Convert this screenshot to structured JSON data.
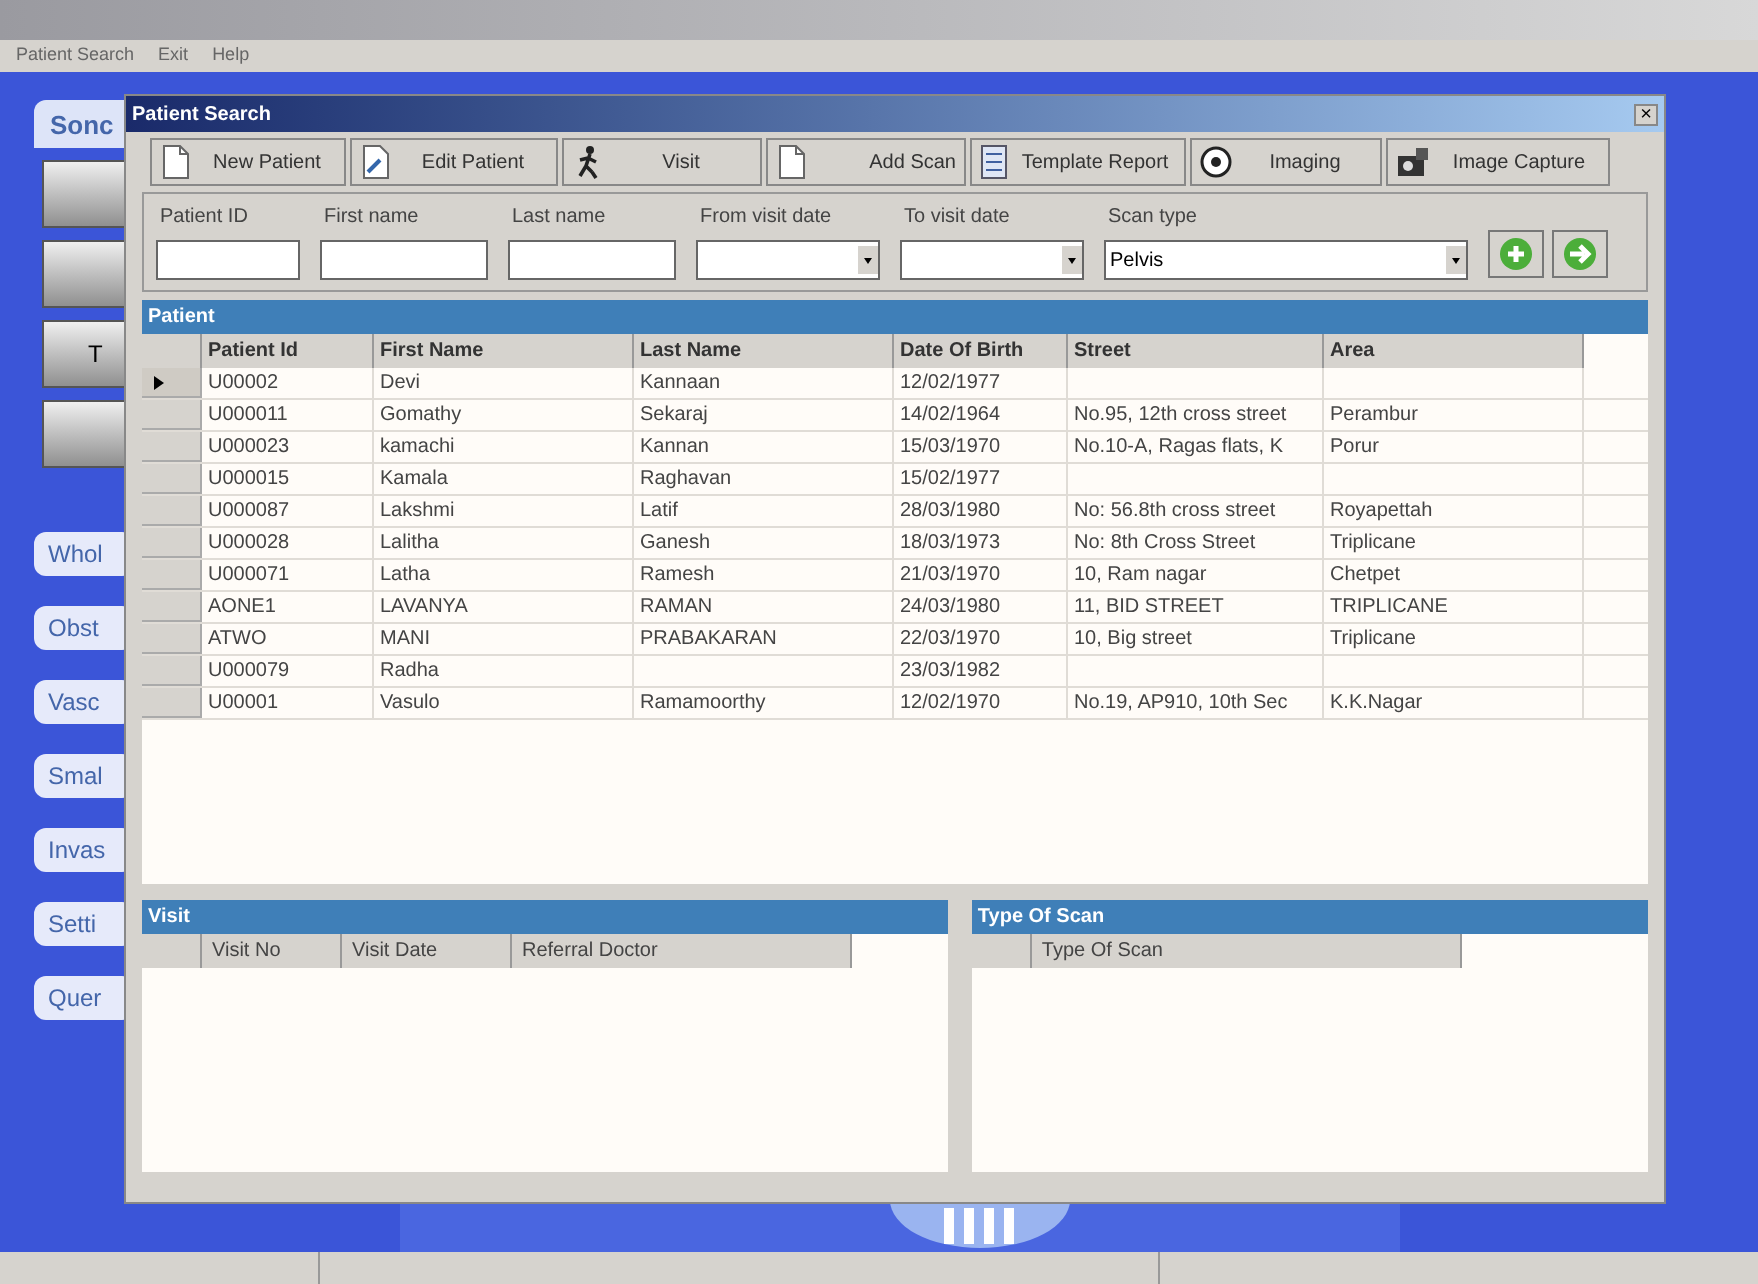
{
  "menu": [
    "Patient Search",
    "Exit",
    "Help"
  ],
  "sidebar": {
    "tab": "Sonc",
    "items": [
      {
        "kind": "blank"
      },
      {
        "kind": "blank"
      },
      {
        "kind": "label",
        "label": "T"
      },
      {
        "kind": "blank"
      }
    ],
    "buttons": [
      "Whol",
      "Obst",
      "Vasc",
      "Smal",
      "Invas",
      "Setti",
      "Quer"
    ]
  },
  "dialog": {
    "title": "Patient Search",
    "close": "×",
    "toolbar": [
      "New Patient",
      "Edit Patient",
      "Visit",
      "Add Scan",
      "Template Report",
      "Imaging",
      "Image Capture"
    ],
    "filters": [
      {
        "label": "Patient ID",
        "kind": "text"
      },
      {
        "label": "First name",
        "kind": "text"
      },
      {
        "label": "Last name",
        "kind": "text"
      },
      {
        "label": "From visit date",
        "kind": "dropdown"
      },
      {
        "label": "To visit date",
        "kind": "dropdown"
      },
      {
        "label": "Scan type",
        "kind": "dropdown",
        "value": "Pelvis"
      }
    ],
    "patient": {
      "title": "Patient",
      "columns": [
        "Patient Id",
        "First Name",
        "Last Name",
        "Date Of Birth",
        "Street",
        "Area"
      ],
      "rows": [
        {
          "selected": true,
          "cells": [
            "U00002",
            "Devi",
            "Kannaan",
            "12/02/1977",
            "",
            ""
          ]
        },
        {
          "selected": false,
          "cells": [
            "U000011",
            "Gomathy",
            "Sekaraj",
            "14/02/1964",
            "No.95, 12th cross street",
            "Perambur"
          ]
        },
        {
          "selected": false,
          "cells": [
            "U000023",
            "kamachi",
            "Kannan",
            "15/03/1970",
            "No.10-A, Ragas flats, K",
            "Porur"
          ]
        },
        {
          "selected": false,
          "cells": [
            "U000015",
            "Kamala",
            "Raghavan",
            "15/02/1977",
            "",
            ""
          ]
        },
        {
          "selected": false,
          "cells": [
            "U000087",
            "Lakshmi",
            "Latif",
            "28/03/1980",
            "No: 56.8th cross street",
            "Royapettah"
          ]
        },
        {
          "selected": false,
          "cells": [
            "U000028",
            "Lalitha",
            "Ganesh",
            "18/03/1973",
            "No: 8th Cross Street",
            "Triplicane"
          ]
        },
        {
          "selected": false,
          "cells": [
            "U000071",
            "Latha",
            "Ramesh",
            "21/03/1970",
            "10, Ram nagar",
            "Chetpet"
          ]
        },
        {
          "selected": false,
          "cells": [
            "AONE1",
            "LAVANYA",
            "RAMAN",
            "24/03/1980",
            "11, BID STREET",
            "TRIPLICANE"
          ]
        },
        {
          "selected": false,
          "cells": [
            "ATWO",
            "MANI",
            "PRABAKARAN",
            "22/03/1970",
            "10, Big street",
            "Triplicane"
          ]
        },
        {
          "selected": false,
          "cells": [
            "U000079",
            "Radha",
            "",
            "23/03/1982",
            "",
            ""
          ]
        },
        {
          "selected": false,
          "cells": [
            "U00001",
            "Vasulo",
            "Ramamoorthy",
            "12/02/1970",
            "No.19, AP910, 10th Sec",
            "K.K.Nagar"
          ]
        }
      ]
    },
    "visit": {
      "title": "Visit",
      "columns": [
        "Visit No",
        "Visit Date",
        "Referral Doctor"
      ]
    },
    "scan": {
      "title": "Type Of Scan",
      "columns": [
        "Type Of Scan"
      ]
    }
  }
}
